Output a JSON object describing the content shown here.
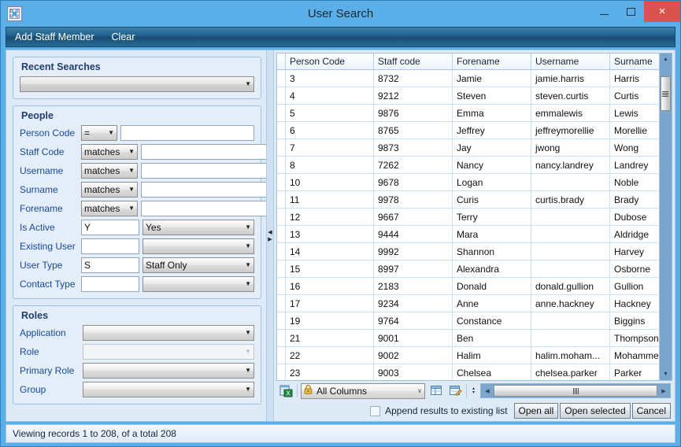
{
  "window": {
    "title": "User Search",
    "app_icon": "app-grid-icon",
    "minimize": "minimize-icon",
    "maximize": "maximize-icon",
    "close": "×"
  },
  "menubar": {
    "items": [
      {
        "label": "Add Staff Member",
        "name": "menu-add-staff-member"
      },
      {
        "label": "Clear",
        "name": "menu-clear"
      }
    ]
  },
  "recent_searches": {
    "title": "Recent Searches",
    "value": "",
    "arrow": "▼"
  },
  "people": {
    "title": "People",
    "rows": [
      {
        "label": "Person Code",
        "op": "=",
        "op_wide": false,
        "value": "",
        "has_text": true,
        "second": null
      },
      {
        "label": "Staff Code",
        "op": "matches",
        "op_wide": true,
        "value": "",
        "has_text": true,
        "second": null
      },
      {
        "label": "Username",
        "op": "matches",
        "op_wide": true,
        "value": "",
        "has_text": true,
        "second": null
      },
      {
        "label": "Surname",
        "op": "matches",
        "op_wide": true,
        "value": "",
        "has_text": true,
        "second": null
      },
      {
        "label": "Forename",
        "op": "matches",
        "op_wide": true,
        "value": "",
        "has_text": true,
        "second": null
      }
    ],
    "code_rows": [
      {
        "label": "Is Active",
        "code": "Y",
        "display": "Yes",
        "disabled": false
      },
      {
        "label": "Existing User",
        "code": "",
        "display": "",
        "disabled": false
      },
      {
        "label": "User Type",
        "code": "S",
        "display": "Staff Only",
        "disabled": false
      },
      {
        "label": "Contact Type",
        "code": "",
        "display": "",
        "disabled": false
      }
    ]
  },
  "roles": {
    "title": "Roles",
    "rows": [
      {
        "label": "Application",
        "value": "",
        "disabled": false
      },
      {
        "label": "Role",
        "value": "",
        "disabled": true
      },
      {
        "label": "Primary Role",
        "value": "",
        "disabled": false
      },
      {
        "label": "Group",
        "value": "",
        "disabled": false
      }
    ]
  },
  "splitter": {
    "left_arrow": "◀",
    "right_arrow": "▶"
  },
  "grid": {
    "columns": [
      "Person Code",
      "Staff code",
      "Forename",
      "Username",
      "Surname"
    ],
    "rows": [
      [
        "3",
        "8732",
        "Jamie",
        "jamie.harris",
        "Harris"
      ],
      [
        "4",
        "9212",
        "Steven",
        "steven.curtis",
        "Curtis"
      ],
      [
        "5",
        "9876",
        "Emma",
        "emmalewis",
        "Lewis"
      ],
      [
        "6",
        "8765",
        "Jeffrey",
        "jeffreymorellie",
        "Morellie"
      ],
      [
        "7",
        "9873",
        "Jay",
        "jwong",
        "Wong"
      ],
      [
        "8",
        "7262",
        "Nancy",
        "nancy.landrey",
        "Landrey"
      ],
      [
        "10",
        "9678",
        "Logan",
        "",
        "Noble"
      ],
      [
        "11",
        "9978",
        "Curis",
        "curtis.brady",
        "Brady"
      ],
      [
        "12",
        "9667",
        "Terry",
        "",
        "Dubose"
      ],
      [
        "13",
        "9444",
        "Mara",
        "",
        "Aldridge"
      ],
      [
        "14",
        "9992",
        "Shannon",
        "",
        "Harvey"
      ],
      [
        "15",
        "8997",
        "Alexandra",
        "",
        "Osborne"
      ],
      [
        "16",
        "2183",
        "Donald",
        "donald.gullion",
        "Gullion"
      ],
      [
        "17",
        "9234",
        "Anne",
        "anne.hackney",
        "Hackney"
      ],
      [
        "19",
        "9764",
        "Constance",
        "",
        "Biggins"
      ],
      [
        "21",
        "9001",
        "Ben",
        "",
        "Thompson"
      ],
      [
        "22",
        "9002",
        "Halim",
        "halim.moham...",
        "Mohammed"
      ],
      [
        "23",
        "9003",
        "Chelsea",
        "chelsea.parker",
        "Parker"
      ]
    ]
  },
  "grid_toolbar": {
    "export_icon": "export-to-excel-icon",
    "column_filter": {
      "lock_icon": "lock-icon",
      "value": "All Columns",
      "arrow": "∨"
    },
    "layout_icon": "grid-layout-icon",
    "edit_layout_icon": "edit-grid-layout-icon",
    "spin_up": "▴",
    "spin_down": "▾",
    "hscroll_left": "◀",
    "hscroll_right": "▶"
  },
  "vscroll": {
    "up": "▲",
    "down": "▼"
  },
  "actions": {
    "append_label": "Append results to existing list",
    "open_all": "Open all",
    "open_selected": "Open selected",
    "cancel": "Cancel"
  },
  "statusbar": {
    "text": "Viewing records 1 to 208, of a total 208"
  },
  "colors": {
    "titlebar": "#5aafe8",
    "menubar": "#1f5f8c",
    "close_button": "#d9534f",
    "panel": "#dfeaf7",
    "label": "#17479e",
    "group_title": "#1f3d70",
    "scrollbar": "#7aa6cd"
  }
}
